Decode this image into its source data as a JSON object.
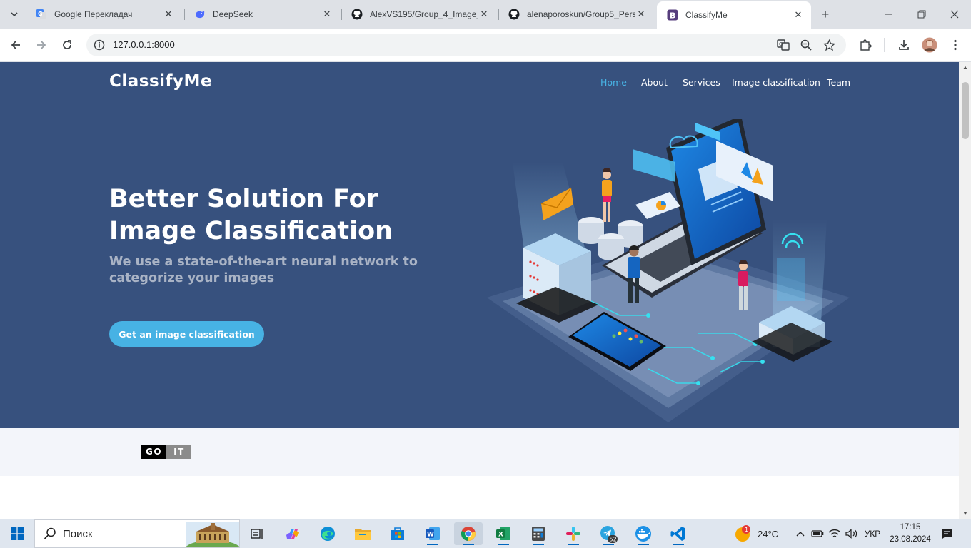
{
  "browser": {
    "tabs": [
      {
        "title": "Google Перекладач",
        "favicon": "google-translate-icon"
      },
      {
        "title": "DeepSeek",
        "favicon": "deepseek-icon"
      },
      {
        "title": "AlexVS195/Group_4_Image_",
        "favicon": "github-icon"
      },
      {
        "title": "alenaporoskun/Group5_Pers",
        "favicon": "github-icon"
      },
      {
        "title": "ClassifyMe",
        "favicon": "bootstrap-icon",
        "active": true
      }
    ],
    "url": "127.0.0.1:8000"
  },
  "site": {
    "brand": "ClassifyMe",
    "nav": [
      "Home",
      "About",
      "Services",
      "Image classification",
      "Team"
    ],
    "hero": {
      "title": "Better Solution For Image Classification",
      "subtitle": "We use a state-of-the-art neural network to categorize your images",
      "cta": "Get an image classification"
    },
    "client_logo": {
      "left": "GO",
      "right": "IT"
    },
    "colors": {
      "hero_bg": "#37517e",
      "accent": "#47b2e4",
      "clients_bg": "#f3f5fa"
    }
  },
  "taskbar": {
    "search_placeholder": "Поиск",
    "weather": "24°C",
    "weather_badge": "1",
    "language": "УКР",
    "time": "17:15",
    "date": "23.08.2024",
    "telegram_badge": "52",
    "apps": [
      "task-view-icon",
      "copilot-icon",
      "edge-icon",
      "file-explorer-icon",
      "microsoft-store-icon",
      "word-icon",
      "chrome-icon",
      "excel-icon",
      "calculator-icon",
      "slack-icon",
      "telegram-icon",
      "docker-icon",
      "vscode-icon"
    ]
  }
}
